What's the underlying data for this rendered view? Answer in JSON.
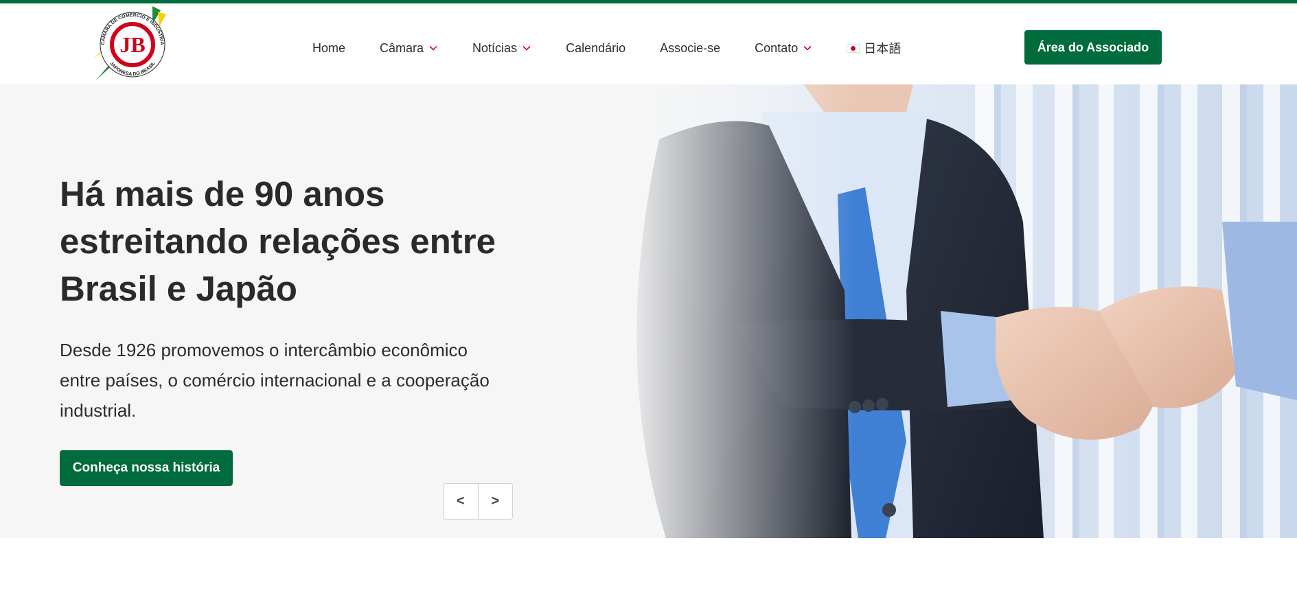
{
  "header": {
    "logo": {
      "monogram": "JB",
      "text_top": "CÂMARA DE COMÉRCIO E INDÚSTRIA",
      "text_bottom": "JAPONESA DO BRASIL",
      "colors": {
        "ring": "#d0021b",
        "green": "#1e8a3c",
        "yellow": "#f5d300"
      }
    },
    "nav": [
      {
        "label": "Home",
        "dropdown": false
      },
      {
        "label": "Câmara",
        "dropdown": true
      },
      {
        "label": "Notícias",
        "dropdown": true
      },
      {
        "label": "Calendário",
        "dropdown": false
      },
      {
        "label": "Associe-se",
        "dropdown": false
      },
      {
        "label": "Contato",
        "dropdown": true
      }
    ],
    "language": {
      "label": "日本語",
      "icon": "japan-flag-icon"
    },
    "cta_label": "Área do Associado"
  },
  "hero": {
    "title": "Há mais de 90 anos estreitando relações entre Brasil e Japão",
    "subtitle": "Desde 1926 promovemos o intercâmbio econômico entre países, o comércio internacional e a cooperação industrial.",
    "button_label": "Conheça nossa história",
    "carousel": {
      "prev_label": "<",
      "next_label": ">"
    },
    "image": "handshake-photo"
  },
  "colors": {
    "brand_green": "#006b3c",
    "accent_red": "#d0021b",
    "hero_bg": "#f6f6f6"
  }
}
